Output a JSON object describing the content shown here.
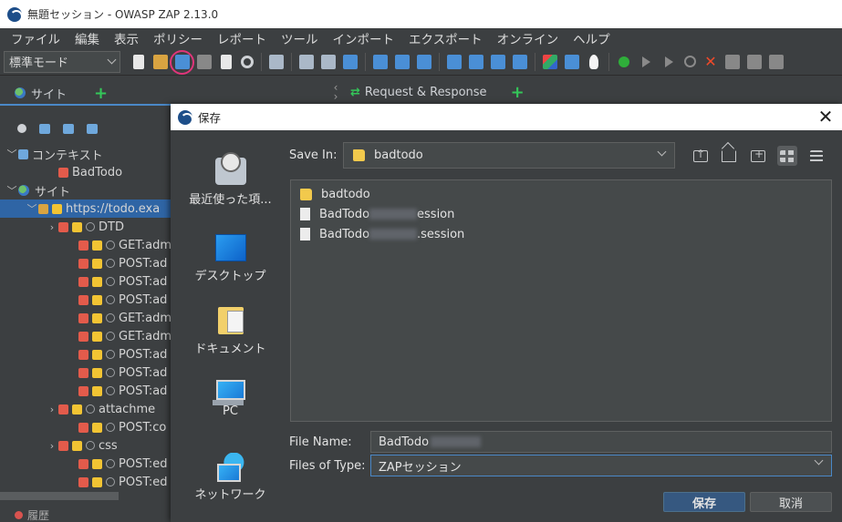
{
  "window": {
    "title": "無題セッション - OWASP ZAP 2.13.0"
  },
  "menu": [
    "ファイル",
    "編集",
    "表示",
    "ポリシー",
    "レポート",
    "ツール",
    "インポート",
    "エクスポート",
    "オンライン",
    "ヘルプ"
  ],
  "toolbar": {
    "mode": "標準モード",
    "highlight_color": "#e0357a"
  },
  "sites_panel": {
    "tab_label": "サイト",
    "tree": [
      {
        "label": "コンテキスト",
        "caret": "﹀",
        "indent": 0,
        "icon": "context"
      },
      {
        "label": "BadTodo",
        "caret": "",
        "indent": 2,
        "icon": "target"
      },
      {
        "label": "サイト",
        "caret": "﹀",
        "indent": 0,
        "icon": "globe"
      },
      {
        "label": "https://todo.exa",
        "caret": "﹀",
        "indent": 1,
        "icon": "folder",
        "selected": true
      },
      {
        "label": "DTD",
        "caret": "›",
        "indent": 2,
        "icon": "node"
      },
      {
        "label": "GET:adm",
        "caret": "",
        "indent": 3,
        "icon": "node"
      },
      {
        "label": "POST:ad",
        "caret": "",
        "indent": 3,
        "icon": "node"
      },
      {
        "label": "POST:ad",
        "caret": "",
        "indent": 3,
        "icon": "node"
      },
      {
        "label": "POST:ad",
        "caret": "",
        "indent": 3,
        "icon": "node"
      },
      {
        "label": "GET:adm",
        "caret": "",
        "indent": 3,
        "icon": "node"
      },
      {
        "label": "GET:adm",
        "caret": "",
        "indent": 3,
        "icon": "node"
      },
      {
        "label": "POST:ad",
        "caret": "",
        "indent": 3,
        "icon": "node"
      },
      {
        "label": "POST:ad",
        "caret": "",
        "indent": 3,
        "icon": "node"
      },
      {
        "label": "POST:ad",
        "caret": "",
        "indent": 3,
        "icon": "node"
      },
      {
        "label": "attachme",
        "caret": "›",
        "indent": 2,
        "icon": "node"
      },
      {
        "label": "POST:co",
        "caret": "",
        "indent": 3,
        "icon": "node"
      },
      {
        "label": "css",
        "caret": "›",
        "indent": 2,
        "icon": "node"
      },
      {
        "label": "POST:ed",
        "caret": "",
        "indent": 3,
        "icon": "node"
      },
      {
        "label": "POST:ed",
        "caret": "",
        "indent": 3,
        "icon": "node"
      }
    ],
    "bottom_tab": "履歴"
  },
  "rr_tab": {
    "label": "Request & Response"
  },
  "dialog": {
    "title": "保存",
    "places": [
      "最近使った項...",
      "デスクトップ",
      "ドキュメント",
      "PC",
      "ネットワーク"
    ],
    "save_in_label": "Save In:",
    "save_in_value": "badtodo",
    "files": [
      {
        "name": "badtodo",
        "type": "folder",
        "suffix": ""
      },
      {
        "name": "BadTodo",
        "type": "file",
        "suffix": "ession"
      },
      {
        "name": "BadTodo",
        "type": "file",
        "suffix": ".session"
      }
    ],
    "file_name_label": "File Name:",
    "file_name_value": "BadTodo",
    "file_type_label": "Files of Type:",
    "file_type_value": "ZAPセッション",
    "save_button": "保存",
    "cancel_button": "取消"
  }
}
